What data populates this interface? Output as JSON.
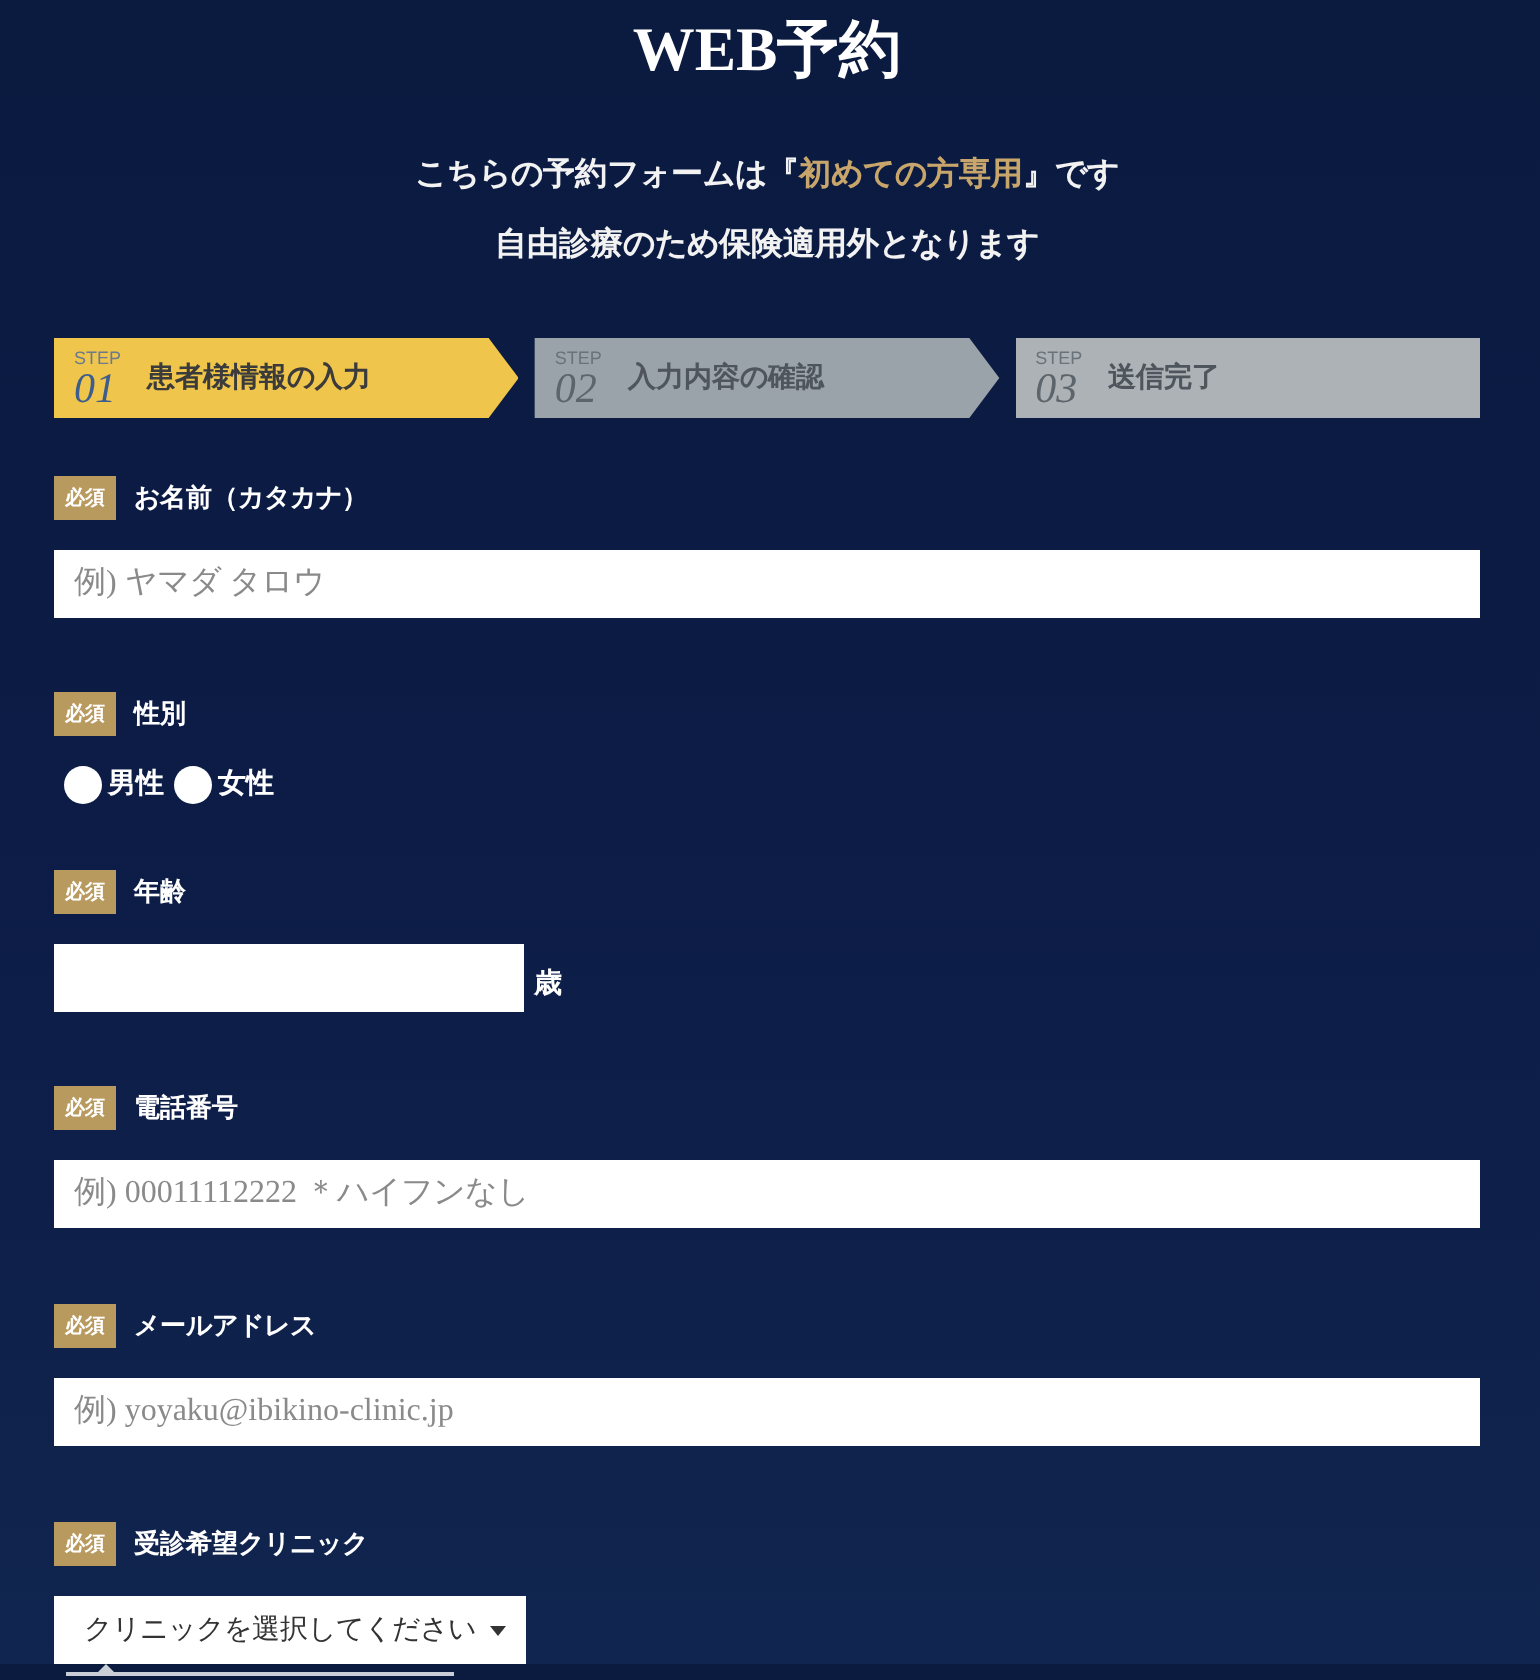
{
  "page": {
    "title": "WEB予約"
  },
  "notice": {
    "lines": [
      {
        "text": "こちらの予約フォームは『",
        "emphasis": "初めての方専用",
        "text_after": "』です"
      },
      {
        "text": "自由診療のため保険適用外となります"
      }
    ]
  },
  "steps": [
    {
      "step_label": "STEP",
      "number": "01",
      "label": "患者様情報の入力",
      "selected": true
    },
    {
      "step_label": "STEP",
      "number": "02",
      "label": "入力内容の確認",
      "selected": false
    },
    {
      "step_label": "STEP",
      "number": "03",
      "label": "送信完了",
      "selected": false
    }
  ],
  "fields": [
    {
      "kind": "text",
      "badge": "必須",
      "label": "お名前（カタカナ）",
      "placeholder": "例) ヤマダ タロウ"
    },
    {
      "kind": "radio",
      "badge": "必須",
      "label": "性別",
      "options": [
        {
          "label": "男性",
          "selected": false
        },
        {
          "label": "女性",
          "selected": false
        }
      ]
    },
    {
      "kind": "number",
      "badge": "必須",
      "label": "年齢",
      "suffix": "歳"
    },
    {
      "kind": "text",
      "badge": "必須",
      "label": "電話番号",
      "placeholder": "例) 00011112222 ＊ハイフンなし"
    },
    {
      "kind": "text",
      "badge": "必須",
      "label": "メールアドレス",
      "placeholder": "例) yoyaku@ibikino-clinic.jp"
    },
    {
      "kind": "select",
      "badge": "必須",
      "label": "受診希望クリニック",
      "value": "クリニックを選択してください",
      "tooltip_open": true
    }
  ]
}
